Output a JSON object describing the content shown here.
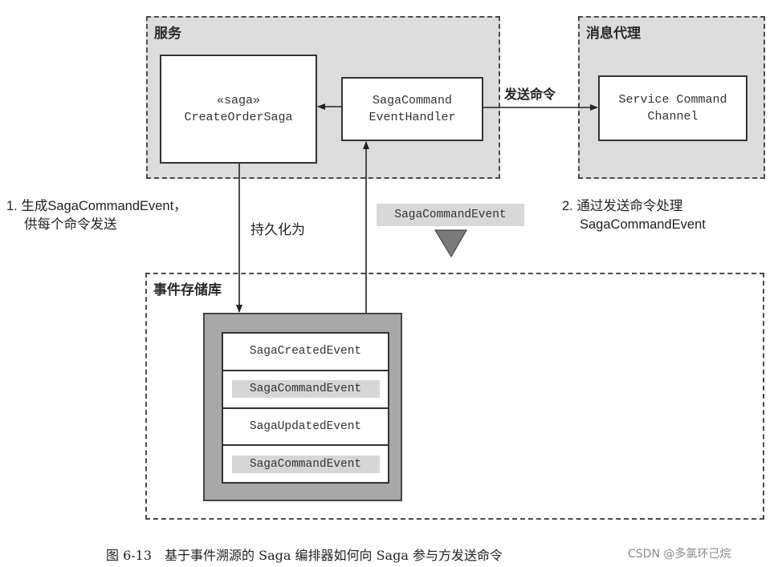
{
  "zones": {
    "service": {
      "title": "服务"
    },
    "broker": {
      "title": "消息代理"
    },
    "event_store": {
      "title": "事件存储库"
    }
  },
  "nodes": {
    "saga": {
      "stereotype": "«saga»",
      "name": "CreateOrderSaga"
    },
    "handler": {
      "line1": "SagaCommand",
      "line2": "EventHandler"
    },
    "channel": {
      "line1": "Service Command",
      "line2": "Channel"
    }
  },
  "edges": {
    "send_command_label": "发送命令",
    "persist_label": "持久化为"
  },
  "notes": {
    "step1_line1": "1. 生成SagaCommandEvent，",
    "step1_line2": "供每个命令发送",
    "step2_line1": "2. 通过发送命令处理",
    "step2_line2": "SagaCommandEvent"
  },
  "legend_event_tag": "SagaCommandEvent",
  "event_store_rows": [
    {
      "label": "SagaCreatedEvent",
      "highlighted": false
    },
    {
      "label": "SagaCommandEvent",
      "highlighted": true
    },
    {
      "label": "SagaUpdatedEvent",
      "highlighted": false
    },
    {
      "label": "SagaCommandEvent",
      "highlighted": true
    }
  ],
  "caption": "图 6-13　基于事件溯源的 Saga 编排器如何向 Saga 参与方发送命令",
  "watermark": "CSDN @多氯环己烷"
}
